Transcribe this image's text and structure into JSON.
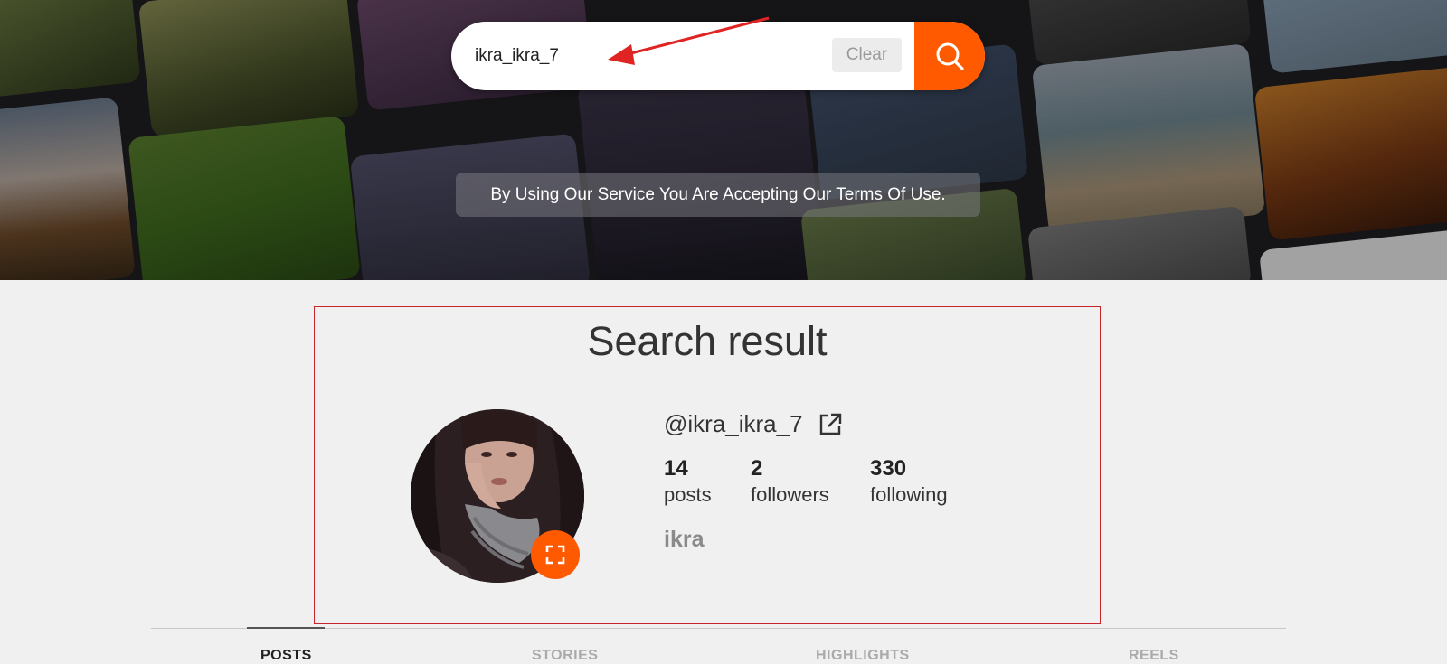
{
  "search": {
    "value": "ikra_ikra_7",
    "clear_label": "Clear"
  },
  "banner": {
    "terms_text": "By Using Our Service You Are Accepting Our Terms Of Use."
  },
  "result": {
    "title": "Search result",
    "username": "@ikra_ikra_7",
    "full_name": "ikra",
    "stats": [
      {
        "value": "14",
        "label": "posts"
      },
      {
        "value": "2",
        "label": "followers"
      },
      {
        "value": "330",
        "label": "following"
      }
    ]
  },
  "tabs": [
    {
      "label": "POSTS",
      "active": true
    },
    {
      "label": "STORIES",
      "active": false
    },
    {
      "label": "HIGHLIGHTS",
      "active": false
    },
    {
      "label": "REELS",
      "active": false
    }
  ],
  "colors": {
    "accent": "#ff5a00",
    "highlight_border": "#c9242b",
    "annotation_arrow": "#e02424"
  },
  "icons": {
    "search_button": "search-icon",
    "external_link": "external-link-icon",
    "expand": "expand-icon"
  }
}
